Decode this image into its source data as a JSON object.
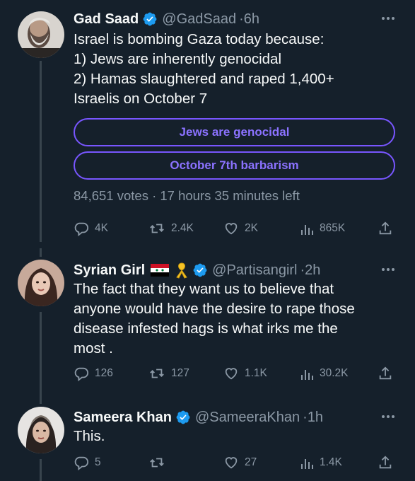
{
  "tweets": [
    {
      "name": "Gad Saad",
      "handle": "@GadSaad",
      "separator": "·",
      "time": "6h",
      "lines": [
        "Israel is bombing Gaza today because:",
        "1) Jews are inherently genocidal",
        "2) Hamas slaughtered and raped 1,400+",
        "Israelis on October 7"
      ],
      "poll": {
        "options": [
          "Jews are genocidal",
          "October 7th barbarism"
        ],
        "meta": "84,651 votes · 17 hours 35 minutes left"
      },
      "stats": {
        "replies": "4K",
        "reposts": "2.4K",
        "likes": "2K",
        "views": "865K"
      }
    },
    {
      "name": "Syrian Girl",
      "handle": "@Partisangirl",
      "separator": "·",
      "time": "2h",
      "name_emojis": [
        "syria-flag-icon",
        "yellow-ribbon-icon"
      ],
      "lines": [
        "The fact that they want us to believe that",
        "anyone would have the desire to rape those",
        "disease infested hags is what irks me the",
        "most ."
      ],
      "stats": {
        "replies": "126",
        "reposts": "127",
        "likes": "1.1K",
        "views": "30.2K"
      }
    },
    {
      "name": "Sameera Khan",
      "handle": "@SameeraKhan",
      "separator": "·",
      "time": "1h",
      "lines": [
        "This."
      ],
      "stats": {
        "replies": "5",
        "reposts": "",
        "likes": "27",
        "views": "1.4K"
      }
    }
  ],
  "colors": {
    "background": "#15202b",
    "text": "#f7f9f9",
    "secondary": "#8b98a5",
    "verified": "#1d9bf0",
    "poll_accent": "#7856ff"
  }
}
